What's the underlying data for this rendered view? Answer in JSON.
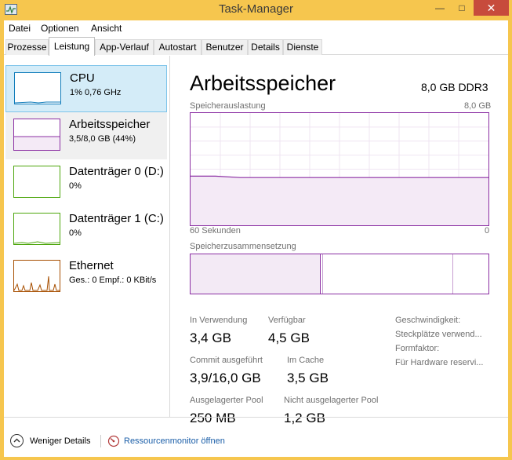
{
  "window": {
    "title": "Task-Manager"
  },
  "menu": {
    "items": [
      "Datei",
      "Optionen",
      "Ansicht"
    ]
  },
  "tabs": [
    "Prozesse",
    "Leistung",
    "App-Verlauf",
    "Autostart",
    "Benutzer",
    "Details",
    "Dienste"
  ],
  "sidebar": {
    "items": [
      {
        "name": "CPU",
        "sub": "1% 0,76 GHz",
        "color": "#117dbb"
      },
      {
        "name": "Arbeitsspeicher",
        "sub": "3,5/8,0 GB (44%)",
        "color": "#8b2fa3"
      },
      {
        "name": "Datenträger 0 (D:)",
        "sub": "0%",
        "color": "#4da60c"
      },
      {
        "name": "Datenträger 1 (C:)",
        "sub": "0%",
        "color": "#4da60c"
      },
      {
        "name": "Ethernet",
        "sub": "Ges.: 0 Empf.: 0 KBit/s",
        "color": "#a74f01"
      }
    ]
  },
  "main": {
    "title": "Arbeitsspeicher",
    "spec": "8,0 GB DDR3",
    "usage_label": "Speicherauslastung",
    "usage_max": "8,0 GB",
    "time_left": "60 Sekunden",
    "time_right": "0",
    "composition_label": "Speicherzusammensetzung",
    "stats": {
      "in_use_label": "In Verwendung",
      "in_use_value": "3,4 GB",
      "available_label": "Verfügbar",
      "available_value": "4,5 GB",
      "commit_label": "Commit ausgeführt",
      "commit_value": "3,9/16,0 GB",
      "cached_label": "Im Cache",
      "cached_value": "3,5 GB",
      "paged_label": "Ausgelagerter Pool",
      "paged_value": "250 MB",
      "nonpaged_label": "Nicht ausgelagerter Pool",
      "nonpaged_value": "1,2 GB"
    },
    "properties": {
      "speed": "Geschwindigkeit:",
      "slots": "Steckplätze verwend...",
      "form_factor": "Formfaktor:",
      "hw_reserved": "Für Hardware reservi..."
    }
  },
  "footer": {
    "fewer_details": "Weniger Details",
    "resource_monitor": "Ressourcenmonitor öffnen"
  },
  "chart_data": {
    "type": "area",
    "title": "Speicherauslastung",
    "ylim": [
      0,
      8
    ],
    "x": [
      60,
      55,
      50,
      45,
      40,
      35,
      30,
      25,
      20,
      15,
      10,
      5,
      0
    ],
    "values": [
      3.5,
      3.5,
      3.4,
      3.4,
      3.4,
      3.4,
      3.4,
      3.4,
      3.4,
      3.4,
      3.4,
      3.4,
      3.4
    ],
    "color": "#8b2fa3"
  }
}
